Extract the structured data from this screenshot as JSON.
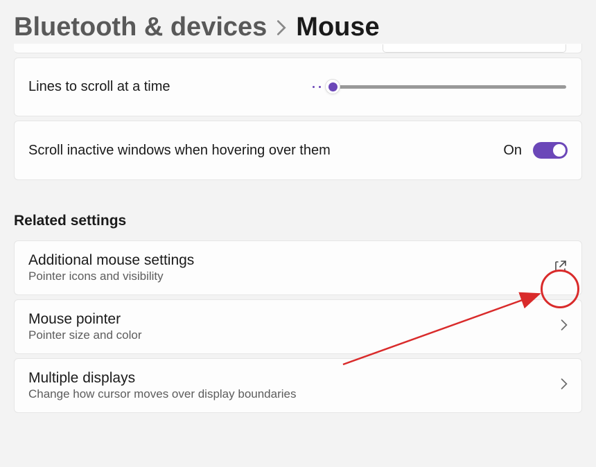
{
  "breadcrumb": {
    "parent": "Bluetooth & devices",
    "current": "Mouse"
  },
  "settings": {
    "linesToScroll": {
      "label": "Lines to scroll at a time"
    },
    "scrollInactive": {
      "label": "Scroll inactive windows when hovering over them",
      "stateText": "On",
      "enabled": true
    }
  },
  "related": {
    "heading": "Related settings",
    "items": [
      {
        "title": "Additional mouse settings",
        "sub": "Pointer icons and visibility",
        "icon": "external"
      },
      {
        "title": "Mouse pointer",
        "sub": "Pointer size and color",
        "icon": "chevron"
      },
      {
        "title": "Multiple displays",
        "sub": "Change how cursor moves over display boundaries",
        "icon": "chevron"
      }
    ]
  },
  "colors": {
    "accent": "#6b47b8",
    "annotation": "#d92b2b"
  }
}
